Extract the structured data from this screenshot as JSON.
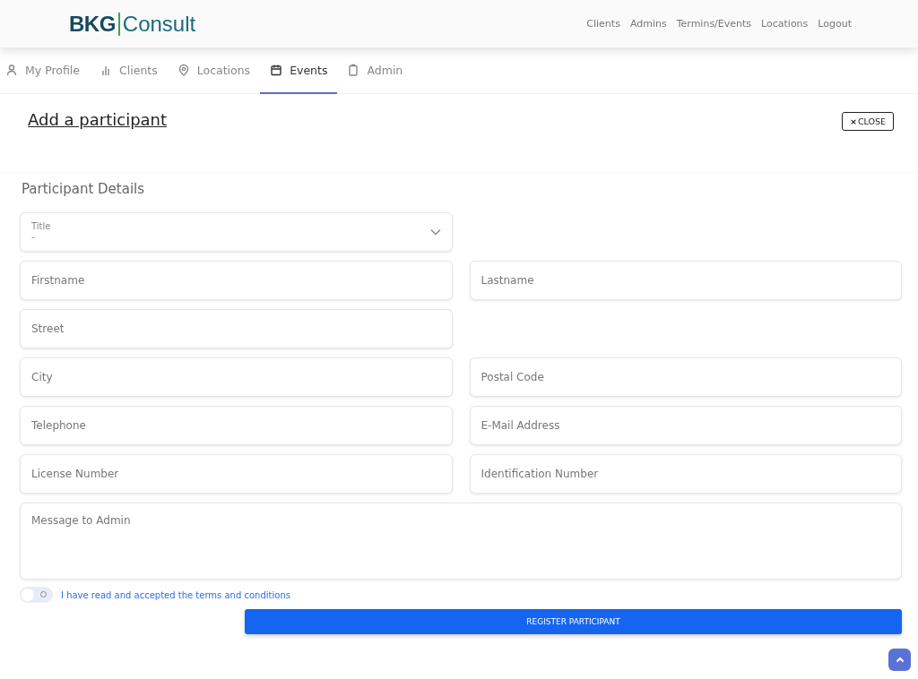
{
  "header": {
    "logo": {
      "left": "BKG",
      "right": "Consult"
    },
    "nav": [
      "Clients",
      "Admins",
      "Termins/Events",
      "Locations",
      "Logout"
    ]
  },
  "tabs": [
    {
      "label": "My Profile",
      "selected": false
    },
    {
      "label": "Clients",
      "selected": false
    },
    {
      "label": "Locations",
      "selected": false
    },
    {
      "label": "Events",
      "selected": true
    },
    {
      "label": "Admin",
      "selected": false
    }
  ],
  "page_title": "Add a participant",
  "close_button": "CLOSE",
  "close_icon": "×",
  "section_title": "Participant Details",
  "rows": [
    [
      {
        "kind": "select",
        "label": "Title",
        "value": "-"
      }
    ],
    [
      {
        "kind": "input",
        "placeholder": "Firstname"
      },
      {
        "kind": "input",
        "placeholder": "Lastname"
      }
    ],
    [
      {
        "kind": "input",
        "placeholder": "Street"
      }
    ],
    [
      {
        "kind": "input",
        "placeholder": "City"
      },
      {
        "kind": "input",
        "placeholder": "Postal Code"
      }
    ],
    [
      {
        "kind": "input",
        "placeholder": "Telephone"
      },
      {
        "kind": "input",
        "placeholder": "E-Mail Address"
      }
    ],
    [
      {
        "kind": "input",
        "placeholder": "License Number"
      },
      {
        "kind": "input",
        "placeholder": "Identification Number"
      }
    ],
    [
      {
        "kind": "textarea",
        "placeholder": "Message to Admin"
      }
    ]
  ],
  "terms": {
    "label": "I have read and accepted the terms and conditions",
    "checked": false
  },
  "submit_button": "REGISTER PARTICIPANT"
}
